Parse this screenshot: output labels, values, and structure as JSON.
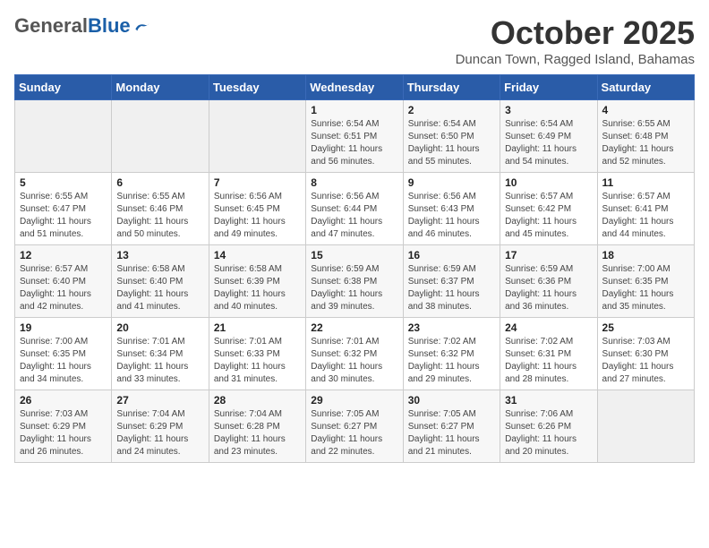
{
  "logo": {
    "general": "General",
    "blue": "Blue"
  },
  "title": "October 2025",
  "location": "Duncan Town, Ragged Island, Bahamas",
  "headers": [
    "Sunday",
    "Monday",
    "Tuesday",
    "Wednesday",
    "Thursday",
    "Friday",
    "Saturday"
  ],
  "weeks": [
    [
      {
        "day": "",
        "sunrise": "",
        "sunset": "",
        "daylight": ""
      },
      {
        "day": "",
        "sunrise": "",
        "sunset": "",
        "daylight": ""
      },
      {
        "day": "",
        "sunrise": "",
        "sunset": "",
        "daylight": ""
      },
      {
        "day": "1",
        "sunrise": "Sunrise: 6:54 AM",
        "sunset": "Sunset: 6:51 PM",
        "daylight": "Daylight: 11 hours and 56 minutes."
      },
      {
        "day": "2",
        "sunrise": "Sunrise: 6:54 AM",
        "sunset": "Sunset: 6:50 PM",
        "daylight": "Daylight: 11 hours and 55 minutes."
      },
      {
        "day": "3",
        "sunrise": "Sunrise: 6:54 AM",
        "sunset": "Sunset: 6:49 PM",
        "daylight": "Daylight: 11 hours and 54 minutes."
      },
      {
        "day": "4",
        "sunrise": "Sunrise: 6:55 AM",
        "sunset": "Sunset: 6:48 PM",
        "daylight": "Daylight: 11 hours and 52 minutes."
      }
    ],
    [
      {
        "day": "5",
        "sunrise": "Sunrise: 6:55 AM",
        "sunset": "Sunset: 6:47 PM",
        "daylight": "Daylight: 11 hours and 51 minutes."
      },
      {
        "day": "6",
        "sunrise": "Sunrise: 6:55 AM",
        "sunset": "Sunset: 6:46 PM",
        "daylight": "Daylight: 11 hours and 50 minutes."
      },
      {
        "day": "7",
        "sunrise": "Sunrise: 6:56 AM",
        "sunset": "Sunset: 6:45 PM",
        "daylight": "Daylight: 11 hours and 49 minutes."
      },
      {
        "day": "8",
        "sunrise": "Sunrise: 6:56 AM",
        "sunset": "Sunset: 6:44 PM",
        "daylight": "Daylight: 11 hours and 47 minutes."
      },
      {
        "day": "9",
        "sunrise": "Sunrise: 6:56 AM",
        "sunset": "Sunset: 6:43 PM",
        "daylight": "Daylight: 11 hours and 46 minutes."
      },
      {
        "day": "10",
        "sunrise": "Sunrise: 6:57 AM",
        "sunset": "Sunset: 6:42 PM",
        "daylight": "Daylight: 11 hours and 45 minutes."
      },
      {
        "day": "11",
        "sunrise": "Sunrise: 6:57 AM",
        "sunset": "Sunset: 6:41 PM",
        "daylight": "Daylight: 11 hours and 44 minutes."
      }
    ],
    [
      {
        "day": "12",
        "sunrise": "Sunrise: 6:57 AM",
        "sunset": "Sunset: 6:40 PM",
        "daylight": "Daylight: 11 hours and 42 minutes."
      },
      {
        "day": "13",
        "sunrise": "Sunrise: 6:58 AM",
        "sunset": "Sunset: 6:40 PM",
        "daylight": "Daylight: 11 hours and 41 minutes."
      },
      {
        "day": "14",
        "sunrise": "Sunrise: 6:58 AM",
        "sunset": "Sunset: 6:39 PM",
        "daylight": "Daylight: 11 hours and 40 minutes."
      },
      {
        "day": "15",
        "sunrise": "Sunrise: 6:59 AM",
        "sunset": "Sunset: 6:38 PM",
        "daylight": "Daylight: 11 hours and 39 minutes."
      },
      {
        "day": "16",
        "sunrise": "Sunrise: 6:59 AM",
        "sunset": "Sunset: 6:37 PM",
        "daylight": "Daylight: 11 hours and 38 minutes."
      },
      {
        "day": "17",
        "sunrise": "Sunrise: 6:59 AM",
        "sunset": "Sunset: 6:36 PM",
        "daylight": "Daylight: 11 hours and 36 minutes."
      },
      {
        "day": "18",
        "sunrise": "Sunrise: 7:00 AM",
        "sunset": "Sunset: 6:35 PM",
        "daylight": "Daylight: 11 hours and 35 minutes."
      }
    ],
    [
      {
        "day": "19",
        "sunrise": "Sunrise: 7:00 AM",
        "sunset": "Sunset: 6:35 PM",
        "daylight": "Daylight: 11 hours and 34 minutes."
      },
      {
        "day": "20",
        "sunrise": "Sunrise: 7:01 AM",
        "sunset": "Sunset: 6:34 PM",
        "daylight": "Daylight: 11 hours and 33 minutes."
      },
      {
        "day": "21",
        "sunrise": "Sunrise: 7:01 AM",
        "sunset": "Sunset: 6:33 PM",
        "daylight": "Daylight: 11 hours and 31 minutes."
      },
      {
        "day": "22",
        "sunrise": "Sunrise: 7:01 AM",
        "sunset": "Sunset: 6:32 PM",
        "daylight": "Daylight: 11 hours and 30 minutes."
      },
      {
        "day": "23",
        "sunrise": "Sunrise: 7:02 AM",
        "sunset": "Sunset: 6:32 PM",
        "daylight": "Daylight: 11 hours and 29 minutes."
      },
      {
        "day": "24",
        "sunrise": "Sunrise: 7:02 AM",
        "sunset": "Sunset: 6:31 PM",
        "daylight": "Daylight: 11 hours and 28 minutes."
      },
      {
        "day": "25",
        "sunrise": "Sunrise: 7:03 AM",
        "sunset": "Sunset: 6:30 PM",
        "daylight": "Daylight: 11 hours and 27 minutes."
      }
    ],
    [
      {
        "day": "26",
        "sunrise": "Sunrise: 7:03 AM",
        "sunset": "Sunset: 6:29 PM",
        "daylight": "Daylight: 11 hours and 26 minutes."
      },
      {
        "day": "27",
        "sunrise": "Sunrise: 7:04 AM",
        "sunset": "Sunset: 6:29 PM",
        "daylight": "Daylight: 11 hours and 24 minutes."
      },
      {
        "day": "28",
        "sunrise": "Sunrise: 7:04 AM",
        "sunset": "Sunset: 6:28 PM",
        "daylight": "Daylight: 11 hours and 23 minutes."
      },
      {
        "day": "29",
        "sunrise": "Sunrise: 7:05 AM",
        "sunset": "Sunset: 6:27 PM",
        "daylight": "Daylight: 11 hours and 22 minutes."
      },
      {
        "day": "30",
        "sunrise": "Sunrise: 7:05 AM",
        "sunset": "Sunset: 6:27 PM",
        "daylight": "Daylight: 11 hours and 21 minutes."
      },
      {
        "day": "31",
        "sunrise": "Sunrise: 7:06 AM",
        "sunset": "Sunset: 6:26 PM",
        "daylight": "Daylight: 11 hours and 20 minutes."
      },
      {
        "day": "",
        "sunrise": "",
        "sunset": "",
        "daylight": ""
      }
    ]
  ]
}
